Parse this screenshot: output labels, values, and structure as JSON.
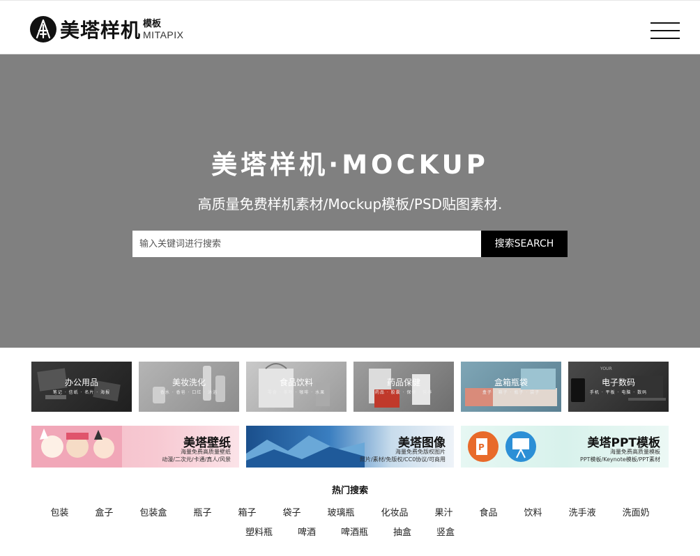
{
  "header": {
    "logo_cn": "美塔样机",
    "logo_sub": "模板",
    "logo_en": "MITAPIX"
  },
  "hero": {
    "title": "美塔样机·MOCKUP",
    "subtitle": "高质量免费样机素材/Mockup模板/PSD贴图素材.",
    "search_placeholder": "输入关键词进行搜索",
    "search_button": "搜索SEARCH",
    "bg_color": "#808080"
  },
  "categories": [
    {
      "title": "办公用品",
      "sub": "笔记 · 信纸 · 名片 · 海报"
    },
    {
      "title": "美妆洗化",
      "sub": "香水 · 香皂 · 口红 · 沐浴"
    },
    {
      "title": "食品饮料",
      "sub": "零食 · 茶叶 · 咖啡 · 水果"
    },
    {
      "title": "药品保健",
      "sub": "药品 · 胶囊 · 保健 · 营养"
    },
    {
      "title": "盒箱瓶袋",
      "sub": "盒子 · 箱子 · 瓶子 · 袋子"
    },
    {
      "title": "电子数码",
      "sub": "手机 · 平板 · 电脑 · 数码"
    }
  ],
  "banners": [
    {
      "title": "美塔壁纸",
      "line1": "海量免费高质量壁纸",
      "line2": "动漫/二次元/卡通/真人/风景"
    },
    {
      "title": "美塔图像",
      "line1": "海量免费免版权图片",
      "line2": "照片/素材/免版权/CC0协议/可商用"
    },
    {
      "title": "美塔PPT模板",
      "line1": "海量免费高质量模板",
      "line2": "PPT模板/Keynote模板/PPT素材"
    }
  ],
  "hot": {
    "title": "热门搜索",
    "row1": [
      "包装",
      "盒子",
      "包装盒",
      "瓶子",
      "箱子",
      "袋子",
      "玻璃瓶",
      "化妆品",
      "果汁",
      "食品",
      "饮料",
      "洗手液",
      "洗面奶"
    ],
    "row2": [
      "塑料瓶",
      "啤酒",
      "啤酒瓶",
      "抽盒",
      "竖盒"
    ]
  }
}
